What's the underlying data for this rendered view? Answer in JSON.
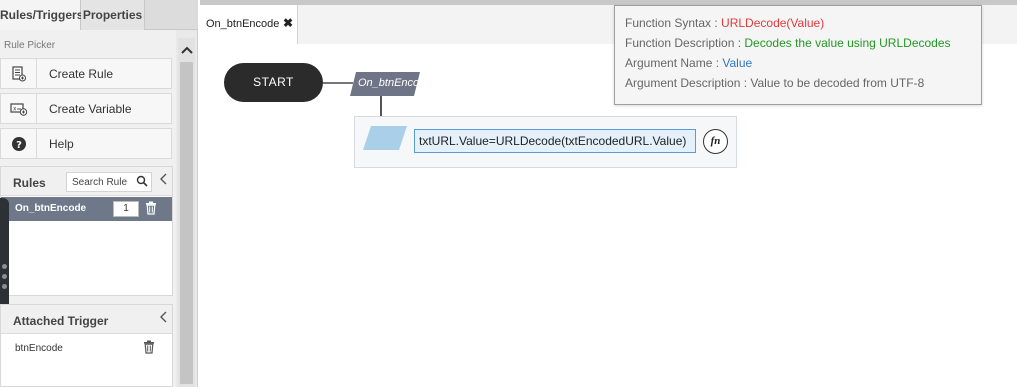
{
  "left_panel": {
    "tabs": [
      "Rules/Triggers",
      "Properties"
    ],
    "picker_title": "Rule Picker",
    "items": [
      {
        "label": "Create Rule",
        "icon": "create-rule-icon"
      },
      {
        "label": "Create Variable",
        "icon": "create-variable-icon"
      },
      {
        "label": "Help",
        "icon": "help-icon"
      }
    ],
    "rules": {
      "title": "Rules",
      "search_placeholder": "Search Rule",
      "items": [
        {
          "name": "On_btnEncode",
          "count": "1"
        }
      ]
    },
    "attached_trigger": {
      "title": "Attached Trigger",
      "items": [
        "btnEncode"
      ]
    }
  },
  "main": {
    "tab": {
      "label": "On_btnEncode",
      "close": "✖"
    },
    "flow": {
      "start_label": "START",
      "event_label": "On_btnEncode",
      "statement": "txtURL.Value=URLDecode(txtEncodedURL.Value)",
      "fn_label": "fn"
    },
    "tooltip": {
      "syntax_label": "Function Syntax : ",
      "syntax_value": "URLDecode(Value)",
      "description_label": "Function Description : ",
      "description_value": "Decodes the value using URLDecodes",
      "arg_name_label": "Argument Name : ",
      "arg_name_value": "Value",
      "arg_desc_label": "Argument Description : ",
      "arg_desc_value": "Value to be decoded from UTF-8"
    }
  },
  "colors": {
    "rule_selected_bg": "#6e7889",
    "syntax_color": "#e23a3a",
    "description_color": "#229922",
    "arg_name_color": "#3575c4",
    "start_node_bg": "#2b2b2b",
    "event_node_bg": "#6f7587",
    "statement_input_bg": "#e4f0fa"
  }
}
